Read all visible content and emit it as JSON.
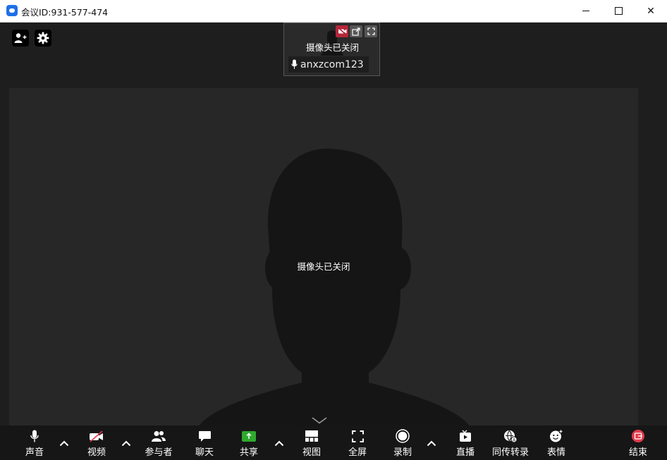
{
  "window": {
    "title": "会议ID:931-577-474",
    "close_glyph": "✕"
  },
  "thumbnail": {
    "status": "摄像头已关闭",
    "name": "anxzcom123"
  },
  "main_video": {
    "status": "摄像头已关闭"
  },
  "toolbar": {
    "audio": "声音",
    "video": "视频",
    "participants": "参与者",
    "chat": "聊天",
    "share": "共享",
    "view": "视图",
    "fullscreen": "全屏",
    "record": "录制",
    "live": "直播",
    "transcribe": "同传转录",
    "reactions": "表情",
    "end": "结束"
  },
  "colors": {
    "share_accent": "#2fa82f",
    "end_accent": "#e23b4e",
    "video_off": "#e23b4e",
    "brand": "#1e6fe8"
  },
  "icons": [
    "add-user-icon",
    "settings-gear-icon",
    "video-off-icon",
    "popout-icon",
    "fullscreen-icon",
    "microphone-icon",
    "video-camera-icon",
    "participants-icon",
    "chat-icon",
    "share-icon",
    "view-grid-icon",
    "fullscreen-icon",
    "record-icon",
    "live-icon",
    "transcribe-icon",
    "emoji-icon",
    "end-icon",
    "chevron-up-icon",
    "chevron-down-icon"
  ]
}
